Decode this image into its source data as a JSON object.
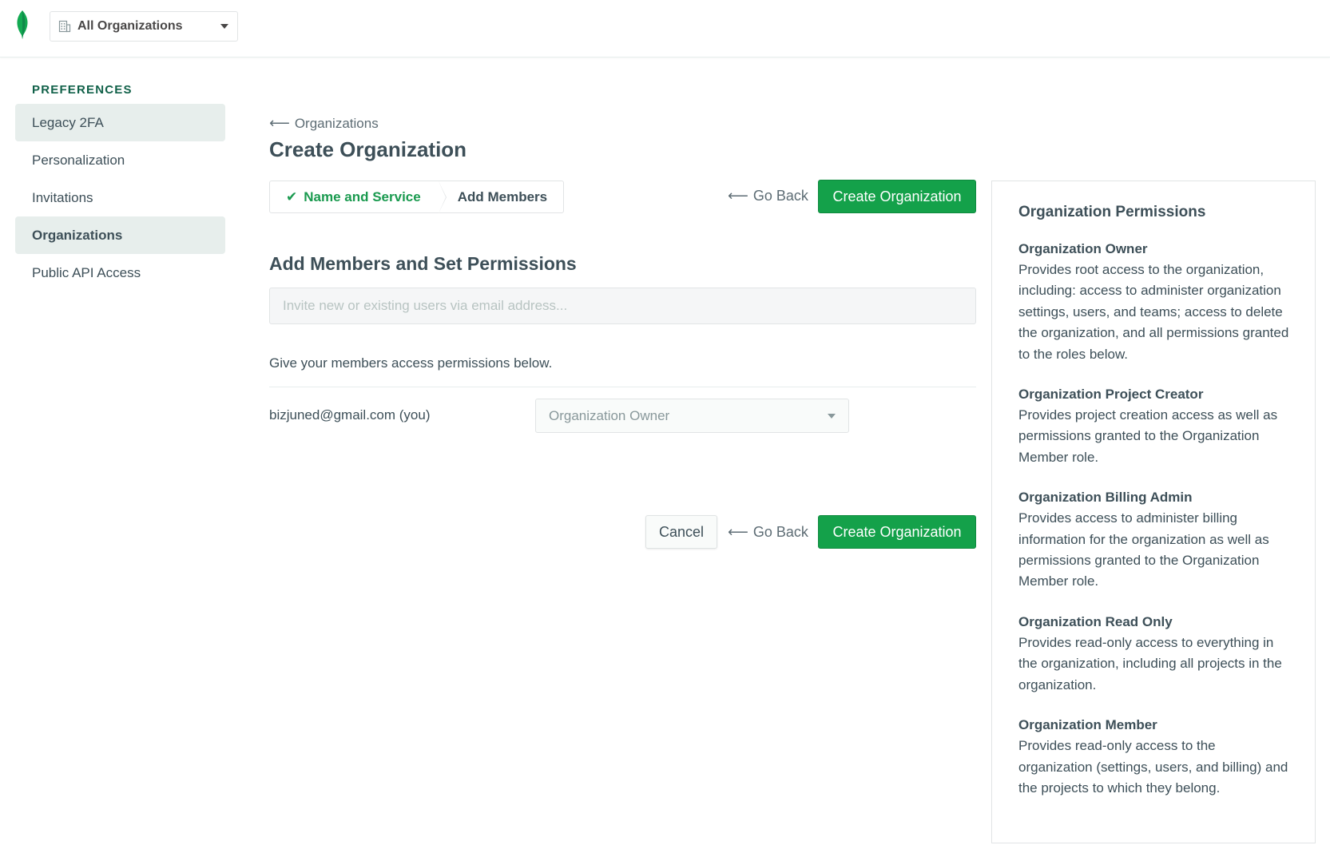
{
  "header": {
    "org_selector_label": "All Organizations"
  },
  "sidebar": {
    "heading": "PREFERENCES",
    "items": [
      {
        "label": "Legacy 2FA"
      },
      {
        "label": "Personalization"
      },
      {
        "label": "Invitations"
      },
      {
        "label": "Organizations"
      },
      {
        "label": "Public API Access"
      }
    ]
  },
  "main": {
    "breadcrumb": "Organizations",
    "title": "Create Organization",
    "steps": [
      {
        "label": "Name and Service",
        "status": "complete"
      },
      {
        "label": "Add Members",
        "status": "current"
      }
    ],
    "go_back_label": "Go Back",
    "create_label": "Create Organization",
    "cancel_label": "Cancel",
    "section_title": "Add Members and Set Permissions",
    "invite_placeholder": "Invite new or existing users via email address...",
    "permissions_note": "Give your members access permissions below.",
    "members": [
      {
        "email": "bizjuned@gmail.com (you)",
        "role": "Organization Owner"
      }
    ]
  },
  "permissions_panel": {
    "title": "Organization Permissions",
    "roles": [
      {
        "name": "Organization Owner",
        "description": "Provides root access to the organization, including: access to administer organization settings, users, and teams; access to delete the organization, and all permissions granted to the roles below."
      },
      {
        "name": "Organization Project Creator",
        "description": "Provides project creation access as well as permissions granted to the Organization Member role."
      },
      {
        "name": "Organization Billing Admin",
        "description": "Provides access to administer billing information for the organization as well as permissions granted to the Organization Member role."
      },
      {
        "name": "Organization Read Only",
        "description": "Provides read-only access to everything in the organization, including all projects in the organization."
      },
      {
        "name": "Organization Member",
        "description": "Provides read-only access to the organization (settings, users, and billing) and the projects to which they belong."
      }
    ]
  },
  "colors": {
    "brand_green": "#13aa52",
    "dark_green": "#116149",
    "text": "#3d4f58",
    "sidebar_active_bg": "#e7eeec"
  },
  "icons": {
    "logo": "leaf-logo-icon",
    "org_selector": "building-icon",
    "dropdown": "caret-down-icon",
    "back": "arrow-left-icon",
    "step_done": "checkmark-icon"
  }
}
